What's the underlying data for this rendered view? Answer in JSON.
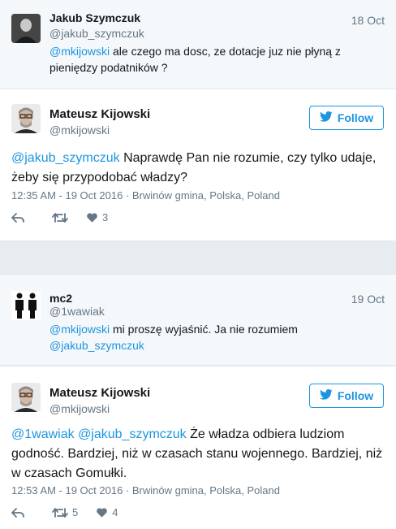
{
  "tweets": [
    {
      "name": "Jakub Szymczuk",
      "handle": "@jakub_szymczuk",
      "date": "18 Oct",
      "mention": "@mkijowski",
      "text": " ale czego ma dosc, ze dotacje juz nie płyną z",
      "text2": "pieniędzy podatników ?"
    },
    {
      "name": "Mateusz Kijowski",
      "handle": "@mkijowski",
      "follow_label": "Follow",
      "mention": "@jakub_szymczuk",
      "text": " Naprawdę Pan nie rozumie, czy tylko udaje,",
      "text2": "żeby się przypodobać władzy?",
      "meta": "12:35 AM - 19 Oct 2016 · Brwinów gmina, Polska, Poland",
      "likes": "3"
    },
    {
      "name": "mc2",
      "handle": "@1wawiak",
      "date": "19 Oct",
      "mention": "@mkijowski",
      "text": " mi proszę wyjaśnić. Ja nie rozumiem",
      "mention2": "@jakub_szymczuk"
    },
    {
      "name": "Mateusz Kijowski",
      "handle": "@mkijowski",
      "follow_label": "Follow",
      "mention": "@1wawiak",
      "mention2": "@jakub_szymczuk",
      "text": " Że władza odbiera ludziom",
      "text2": "godność. Bardziej, niż w czasach stanu wojennego. Bardziej, niż",
      "text3": "w czasach Gomułki.",
      "meta": "12:53 AM - 19 Oct 2016 · Brwinów gmina, Polska, Poland",
      "retweets": "5",
      "likes": "4"
    }
  ],
  "icons": [
    "reply-icon",
    "retweet-icon",
    "heart-icon",
    "twitter-bird-icon"
  ],
  "colors": {
    "accent": "#1b95e0",
    "muted": "#657786",
    "reply_bg": "#f5f8fa",
    "page_bg": "#e6ecf0"
  }
}
